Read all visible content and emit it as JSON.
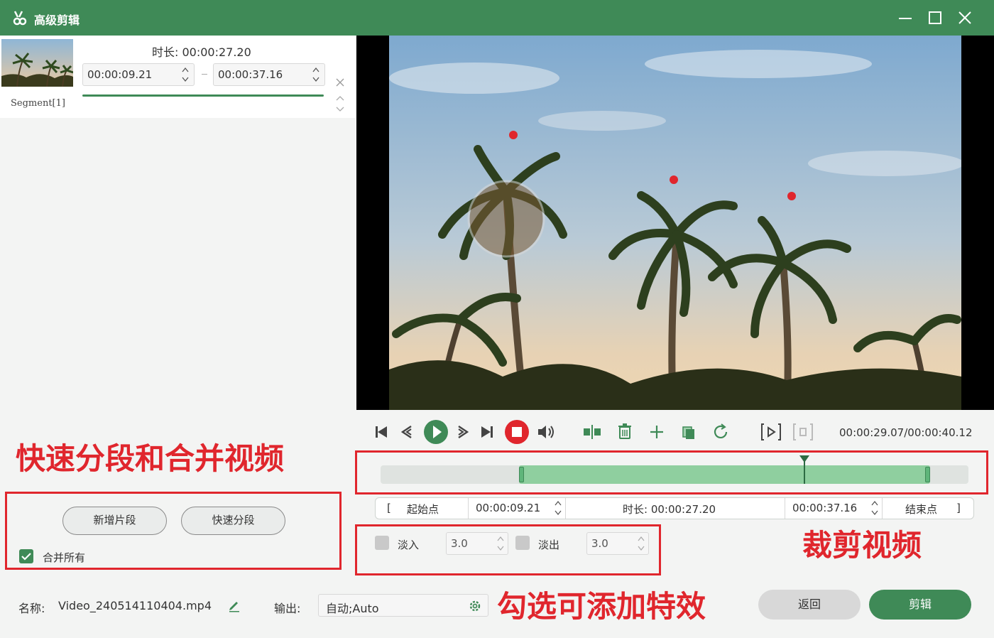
{
  "window": {
    "title": "高级剪辑"
  },
  "segment": {
    "label": "Segment[1]",
    "duration_text": "时长:  00:00:27.20",
    "start": "00:00:09.21",
    "end": "00:00:37.16"
  },
  "annotations": {
    "left": "快速分段和合并视频",
    "trim": "裁剪视频",
    "effects": "勾选可添加特效"
  },
  "segment_actions": {
    "new_segment": "新增片段",
    "quick_split": "快速分段",
    "merge_all": "合并所有",
    "merge_all_checked": true
  },
  "player": {
    "timecode": "00:00:29.07/00:00:40.12",
    "selection_start_fraction": 0.235,
    "selection_end_fraction": 0.935,
    "cursor_fraction": 0.72
  },
  "trim": {
    "start_label": "起始点",
    "start_value": "00:00:09.21",
    "duration_text": "时长:  00:00:27.20",
    "end_value": "00:00:37.16",
    "end_label": "结束点"
  },
  "fade": {
    "fade_in_label": "淡入",
    "fade_in_value": "3.0",
    "fade_out_label": "淡出",
    "fade_out_value": "3.0"
  },
  "footer": {
    "name_label": "名称:",
    "filename": "Video_240514110404.mp4",
    "output_label": "输出:",
    "output_value": "自动;Auto",
    "back_label": "返回",
    "cut_label": "剪辑"
  },
  "colors": {
    "brand": "#3f8a57",
    "annotation": "#e0262d"
  }
}
